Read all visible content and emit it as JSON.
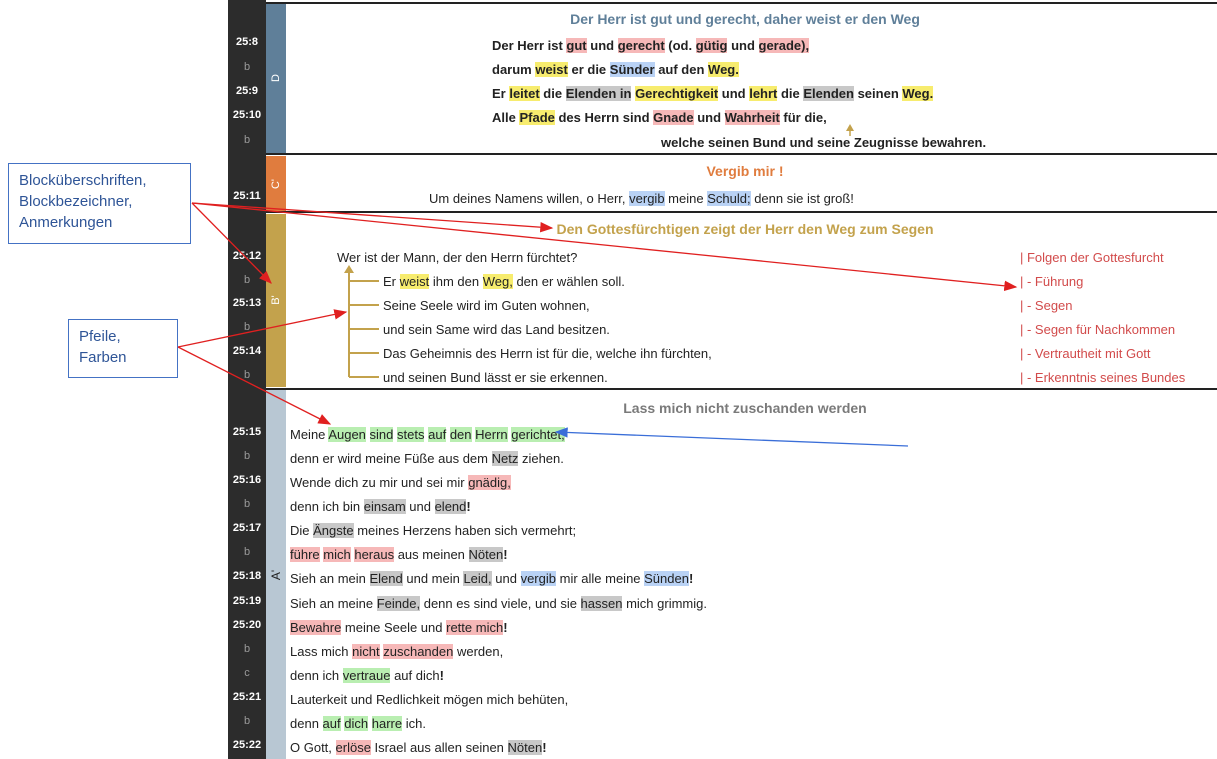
{
  "verses": {
    "v25_8": "25:8",
    "v25_8b": "b",
    "v25_9": "25:9",
    "v25_10": "25:10",
    "v25_10b": "b",
    "v25_11": "25:11",
    "v25_12": "25:12",
    "v25_12b": "b",
    "v25_13": "25:13",
    "v25_13b": "b",
    "v25_14": "25:14",
    "v25_14b": "b",
    "v25_15": "25:15",
    "v25_15b": "b",
    "v25_16": "25:16",
    "v25_16b": "b",
    "v25_17": "25:17",
    "v25_17b": "b",
    "v25_18": "25:18",
    "v25_19": "25:19",
    "v25_20": "25:20",
    "v25_20b": "b",
    "v25_20c": "c",
    "v25_21": "25:21",
    "v25_21b": "b",
    "v25_22": "25:22"
  },
  "blocks": {
    "D": {
      "label": "D",
      "color": "#5f7f99",
      "title": "Der Herr ist gut und gerecht, daher weist er den Weg",
      "title_color": "#5f7f99"
    },
    "C": {
      "label": "C'",
      "color": "#e07c3e",
      "title": "Vergib mir !",
      "title_color": "#e07c3e"
    },
    "B": {
      "label": "B'",
      "color": "#c3a24c",
      "title": "Den Gottesfürchtigen zeigt der Herr den Weg zum Segen",
      "title_color": "#c3a24c"
    },
    "A": {
      "label": "A'",
      "color": "#b8c7d3",
      "title": "Lass mich nicht zuschanden werden",
      "title_color": "#7a7a7a"
    }
  },
  "blockD": {
    "l1": [
      "Der Herr ist ",
      "gut",
      " und ",
      "gerecht",
      " (od. ",
      "gütig",
      " und ",
      "gerade),"
    ],
    "l2": [
      "darum ",
      "weist",
      " er die ",
      "Sünder",
      " auf den ",
      "Weg."
    ],
    "l3": [
      "Er ",
      "leitet",
      " die ",
      "Elenden in",
      " ",
      "Gerechtigkeit",
      " und ",
      "lehrt",
      " die ",
      "Elenden",
      " seinen ",
      "Weg."
    ],
    "l4": [
      "Alle ",
      "Pfade",
      " des Herrn sind ",
      "Gnade",
      " und ",
      "Wahrheit",
      " für die,"
    ],
    "l5": "welche seinen Bund und seine Zeugnisse bewahren."
  },
  "blockC": {
    "l1": [
      "Um deines Namens willen, o Herr, ",
      "vergib",
      " meine ",
      "Schuld;",
      " denn sie ist groß!"
    ]
  },
  "blockB": {
    "l1": "Wer ist der Mann, der den Herrn fürchtet?",
    "l2": [
      "Er ",
      "weist",
      " ihm den ",
      "Weg,",
      " den er wählen soll."
    ],
    "l3": "Seine Seele wird im Guten wohnen,",
    "l4": "und sein Same wird das Land besitzen.",
    "l5": "Das Geheimnis des Herrn ist für die, welche ihn fürchten,",
    "l6": "und seinen Bund lässt er sie erkennen.",
    "notes": [
      "| Folgen der Gottesfurcht",
      "| - Führung",
      "| - Segen",
      "| - Segen für Nachkommen",
      "| - Vertrautheit mit Gott",
      "| - Erkenntnis seines Bundes"
    ]
  },
  "blockA": {
    "l1": [
      "Meine ",
      "Augen",
      " ",
      "sind",
      " ",
      "stets",
      " ",
      "auf",
      " ",
      "den",
      " ",
      "Herrn",
      " ",
      "gerichtet;"
    ],
    "l2": [
      "denn er wird meine Füße aus dem ",
      "Netz",
      " ziehen."
    ],
    "l3": [
      "Wende dich zu mir und sei mir ",
      "gnädig,"
    ],
    "l4": [
      "denn ich bin ",
      "einsam",
      " und ",
      "elend",
      "!"
    ],
    "l5": [
      "Die ",
      "Ängste",
      " meines Herzens haben sich vermehrt;"
    ],
    "l6": [
      "führe",
      " ",
      "mich",
      " ",
      "heraus",
      " aus meinen ",
      "Nöten",
      "!"
    ],
    "l7": [
      "Sieh an mein ",
      "Elend",
      " und mein ",
      "Leid,",
      " und ",
      "vergib",
      " mir alle meine ",
      "Sünden",
      "!"
    ],
    "l8": [
      "Sieh an meine ",
      "Feinde,",
      " denn es sind viele, und sie ",
      "hassen",
      " mich grimmig."
    ],
    "l9": [
      " ",
      "Bewahre",
      " meine Seele und ",
      "rette mich",
      "!"
    ],
    "l10": [
      "Lass mich ",
      "nicht",
      " ",
      "zuschanden",
      " werden,"
    ],
    "l11": [
      "denn ich ",
      "vertraue",
      " auf dich",
      "!"
    ],
    "l12": "Lauterkeit und Redlichkeit mögen mich behüten,",
    "l13": [
      "denn ",
      "auf",
      " ",
      "dich",
      " ",
      "harre",
      " ich."
    ],
    "l14": [
      "O Gott, ",
      "erlöse",
      " Israel aus allen seinen ",
      "Nöten",
      "!"
    ]
  },
  "callouts": {
    "c1": [
      "Blocküberschriften,",
      "Blockbezeichner,",
      "Anmerkungen"
    ],
    "c2": [
      "Pfeile,",
      "Farben"
    ]
  },
  "colors": {
    "highlight_yellow": "#f7ec6e",
    "highlight_red": "#f6b8b8",
    "highlight_gray": "#c8c8c8",
    "highlight_blue": "#b9d2f5",
    "highlight_green": "#b9eeb1",
    "note_red": "#d24b4b",
    "arrow_red": "#e02020",
    "arrow_blue": "#3a6ed8"
  }
}
